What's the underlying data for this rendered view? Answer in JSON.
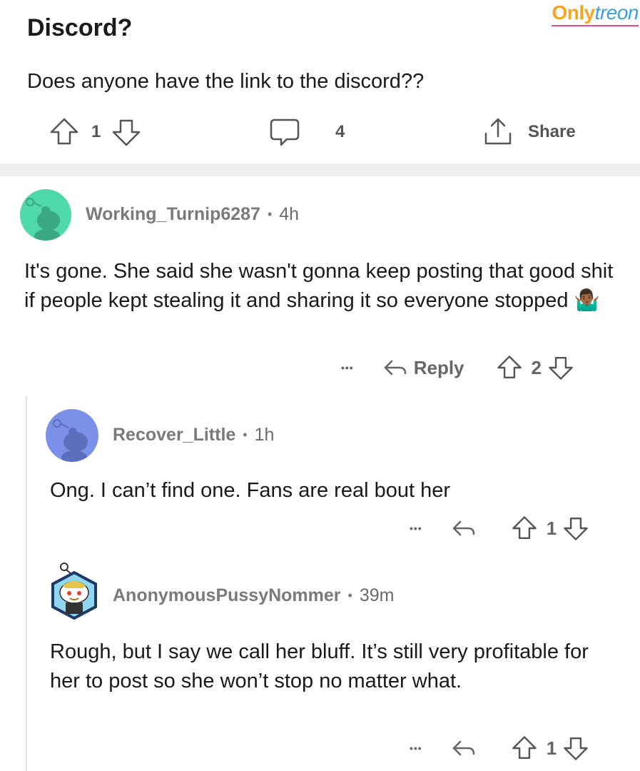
{
  "watermark": {
    "part1": "Only",
    "part2": "treon"
  },
  "post": {
    "title": "Discord?",
    "body": "Does anyone have the link to the discord??",
    "upvotes": "1",
    "comments": "4",
    "share_label": "Share"
  },
  "comments": [
    {
      "username": "Working_Turnip6287",
      "age": "4h",
      "text": "It's gone. She said she wasn't gonna keep posting that good shit if people kept stealing it and sharing it so everyone stopped",
      "emoji": "🤷🏾‍♂️",
      "reply_label": "Reply",
      "votes": "2",
      "more": "•••",
      "avatar_color": "#4fd8a8"
    },
    {
      "username": "Recover_Little",
      "age": "1h",
      "text": "Ong. I can’t find one. Fans are real bout her",
      "votes": "1",
      "more": "•••",
      "avatar_color": "#7b90e8"
    },
    {
      "username": "AnonymousPussyNommer",
      "age": "39m",
      "text": "Rough, but I say we call her bluff. It’s still very profitable for her to post so she won’t stop no matter what.",
      "votes": "1",
      "more": "•••",
      "avatar_color": "#8fd6ee"
    }
  ],
  "icons": {
    "upvote": "upvote-icon",
    "downvote": "downvote-icon",
    "comment": "comment-bubble-icon",
    "share": "share-icon",
    "reply": "reply-arrow-icon",
    "more": "more-options-icon"
  },
  "colors": {
    "text": "#1a1a1b",
    "meta": "#7a7a7a",
    "divider": "#efefef"
  }
}
